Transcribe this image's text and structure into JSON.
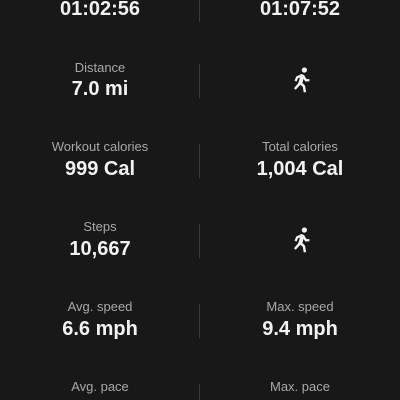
{
  "top": {
    "left_time": "01:02:56",
    "right_time": "01:07:52"
  },
  "rows": [
    {
      "left_label": "Distance",
      "left_value": "7.0 mi",
      "right_icon": "running-person-icon"
    },
    {
      "left_label": "Workout calories",
      "left_value": "999 Cal",
      "right_label": "Total calories",
      "right_value": "1,004 Cal"
    },
    {
      "left_label": "Steps",
      "left_value": "10,667",
      "right_icon": "running-person-icon"
    },
    {
      "left_label": "Avg. speed",
      "left_value": "6.6 mph",
      "right_label": "Max. speed",
      "right_value": "9.4 mph"
    },
    {
      "left_label": "Avg. pace",
      "right_label": "Max. pace"
    }
  ]
}
